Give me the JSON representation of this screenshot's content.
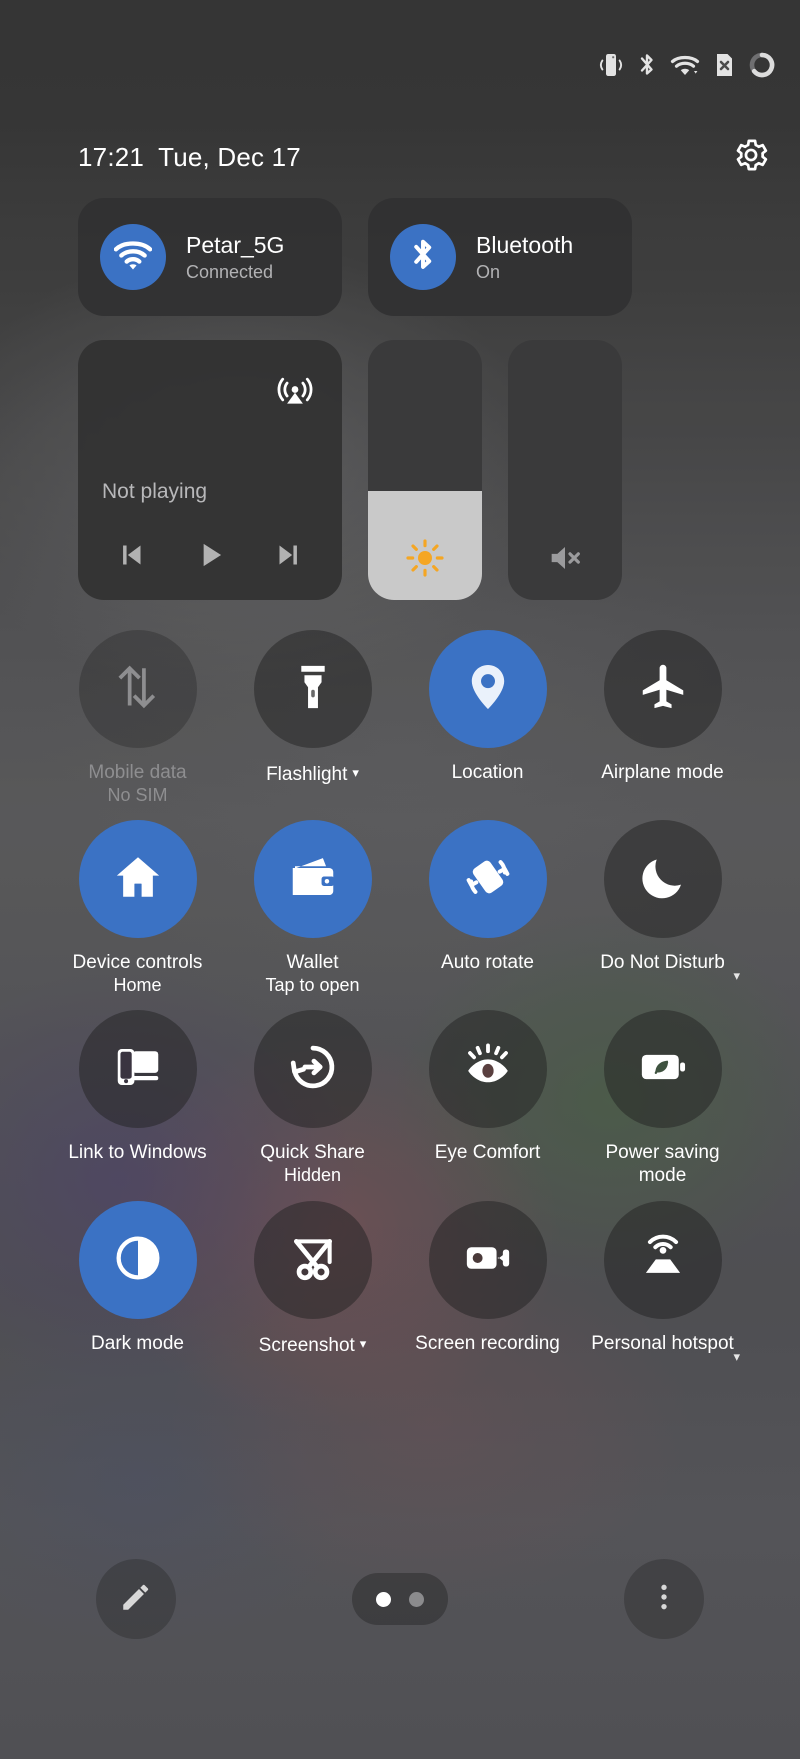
{
  "statusbar": {
    "icons": [
      {
        "name": "vibrate-icon",
        "label": "Vibrate"
      },
      {
        "name": "bluetooth-icon",
        "label": "Bluetooth"
      },
      {
        "name": "wifi-icon",
        "label": "Wi-Fi"
      },
      {
        "name": "no-sim-icon",
        "label": "No SIM"
      },
      {
        "name": "battery-circle-icon",
        "label": "Battery"
      }
    ]
  },
  "header": {
    "time": "17:21",
    "date": "Tue, Dec 17",
    "settings_icon": "gear-icon"
  },
  "connectivity": [
    {
      "name": "wifi",
      "icon": "wifi-icon",
      "title": "Petar_5G",
      "subtitle": "Connected",
      "active": true
    },
    {
      "name": "bluetooth",
      "icon": "bluetooth-icon",
      "title": "Bluetooth",
      "subtitle": "On",
      "active": true
    }
  ],
  "media": {
    "cast_icon": "cast-icon",
    "status": "Not playing",
    "controls": [
      {
        "name": "previous-track-button",
        "icon": "skip-previous-icon"
      },
      {
        "name": "play-button",
        "icon": "play-icon"
      },
      {
        "name": "next-track-button",
        "icon": "skip-next-icon"
      }
    ]
  },
  "sliders": [
    {
      "name": "brightness-slider",
      "icon": "brightness-sun-icon",
      "level": 42,
      "muted": false
    },
    {
      "name": "volume-slider",
      "icon": "volume-mute-icon",
      "level": 0,
      "muted": true
    }
  ],
  "tiles": [
    {
      "name": "mobile-data",
      "icon": "mobile-data-icon",
      "label": "Mobile data",
      "sub": "No SIM",
      "state": "disabled",
      "caret": "none"
    },
    {
      "name": "flashlight",
      "icon": "flashlight-icon",
      "label": "Flashlight",
      "sub": "",
      "state": "off",
      "caret": "inline"
    },
    {
      "name": "location",
      "icon": "location-pin-icon",
      "label": "Location",
      "sub": "",
      "state": "on",
      "caret": "none"
    },
    {
      "name": "airplane-mode",
      "icon": "airplane-icon",
      "label": "Airplane mode",
      "sub": "",
      "state": "off",
      "caret": "none"
    },
    {
      "name": "device-controls",
      "icon": "home-icon",
      "label": "Device controls",
      "sub": "Home",
      "state": "on",
      "caret": "none"
    },
    {
      "name": "wallet",
      "icon": "wallet-icon",
      "label": "Wallet",
      "sub": "Tap to open",
      "state": "on",
      "caret": "none"
    },
    {
      "name": "auto-rotate",
      "icon": "auto-rotate-icon",
      "label": "Auto rotate",
      "sub": "",
      "state": "on",
      "caret": "none"
    },
    {
      "name": "do-not-disturb",
      "icon": "moon-icon",
      "label": "Do Not Disturb",
      "sub": "",
      "state": "off",
      "caret": "side"
    },
    {
      "name": "link-to-windows",
      "icon": "link-to-windows-icon",
      "label": "Link to Windows",
      "sub": "",
      "state": "off",
      "caret": "none"
    },
    {
      "name": "quick-share",
      "icon": "quick-share-icon",
      "label": "Quick Share",
      "sub": "Hidden",
      "state": "off",
      "caret": "none"
    },
    {
      "name": "eye-comfort",
      "icon": "eye-comfort-icon",
      "label": "Eye Comfort",
      "sub": "",
      "state": "off",
      "caret": "none"
    },
    {
      "name": "power-saving-mode",
      "icon": "power-saving-icon",
      "label": "Power saving mode",
      "sub": "",
      "state": "off",
      "caret": "none"
    },
    {
      "name": "dark-mode",
      "icon": "dark-mode-icon",
      "label": "Dark mode",
      "sub": "",
      "state": "on",
      "caret": "none"
    },
    {
      "name": "screenshot",
      "icon": "screenshot-scissors-icon",
      "label": "Screenshot",
      "sub": "",
      "state": "off",
      "caret": "inline"
    },
    {
      "name": "screen-recording",
      "icon": "video-camera-icon",
      "label": "Screen recording",
      "sub": "",
      "state": "off",
      "caret": "none"
    },
    {
      "name": "personal-hotspot",
      "icon": "hotspot-icon",
      "label": "Personal hotspot",
      "sub": "",
      "state": "off",
      "caret": "side"
    }
  ],
  "bottombar": {
    "edit_icon": "pencil-icon",
    "more_icon": "three-dot-menu-icon",
    "pages": 2,
    "active_page": 1
  },
  "colors": {
    "accent_blue": "#3b72c4",
    "tile_off": "rgba(34,34,34,0.50)",
    "text_primary": "#ffffff",
    "text_secondary": "#b2b2b4",
    "text_disabled": "#8e8e90",
    "brightness_fill": "#c9c9c9",
    "sun_orange": "#f5a623"
  }
}
